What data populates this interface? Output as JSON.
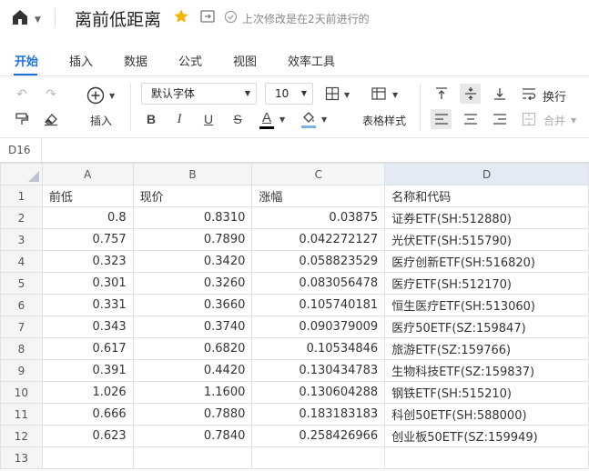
{
  "doc": {
    "title": "离前低距离",
    "saved_status": "上次修改是在2天前进行的"
  },
  "tabs": [
    {
      "label": "开始",
      "active": true
    },
    {
      "label": "插入",
      "active": false
    },
    {
      "label": "数据",
      "active": false
    },
    {
      "label": "公式",
      "active": false
    },
    {
      "label": "视图",
      "active": false
    },
    {
      "label": "效率工具",
      "active": false
    }
  ],
  "toolbar": {
    "insert_label": "插入",
    "font_family": "默认字体",
    "font_size": "10",
    "table_style_label": "表格样式",
    "wrap_label": "换行",
    "merge_label": "合并",
    "bold": "B",
    "italic": "I",
    "underline": "U",
    "strike": "S",
    "font_color_letter": "A",
    "font_color": "#000000",
    "accent_color": "#1f6fe0"
  },
  "namebox": "D16",
  "columns": [
    "A",
    "B",
    "C",
    "D"
  ],
  "rows": [
    {
      "n": "1",
      "a": "前低",
      "b": "现价",
      "c": "涨幅",
      "d": "名称和代码",
      "header": true
    },
    {
      "n": "2",
      "a": "0.8",
      "b": "0.8310",
      "c": "0.03875",
      "d": "证券ETF(SH:512880)"
    },
    {
      "n": "3",
      "a": "0.757",
      "b": "0.7890",
      "c": "0.042272127",
      "d": "光伏ETF(SH:515790)"
    },
    {
      "n": "4",
      "a": "0.323",
      "b": "0.3420",
      "c": "0.058823529",
      "d": "医疗创新ETF(SH:516820)"
    },
    {
      "n": "5",
      "a": "0.301",
      "b": "0.3260",
      "c": "0.083056478",
      "d": "医疗ETF(SH:512170)"
    },
    {
      "n": "6",
      "a": "0.331",
      "b": "0.3660",
      "c": "0.105740181",
      "d": "恒生医疗ETF(SH:513060)"
    },
    {
      "n": "7",
      "a": "0.343",
      "b": "0.3740",
      "c": "0.090379009",
      "d": "医疗50ETF(SZ:159847)"
    },
    {
      "n": "8",
      "a": "0.617",
      "b": "0.6820",
      "c": "0.10534846",
      "d": "旅游ETF(SZ:159766)"
    },
    {
      "n": "9",
      "a": "0.391",
      "b": "0.4420",
      "c": "0.130434783",
      "d": "生物科技ETF(SZ:159837)"
    },
    {
      "n": "10",
      "a": "1.026",
      "b": "1.1600",
      "c": "0.130604288",
      "d": "钢铁ETF(SH:515210)"
    },
    {
      "n": "11",
      "a": "0.666",
      "b": "0.7880",
      "c": "0.183183183",
      "d": "科创50ETF(SH:588000)"
    },
    {
      "n": "12",
      "a": "0.623",
      "b": "0.7840",
      "c": "0.258426966",
      "d": "创业板50ETF(SZ:159949)"
    },
    {
      "n": "13",
      "a": "",
      "b": "",
      "c": "",
      "d": ""
    }
  ]
}
